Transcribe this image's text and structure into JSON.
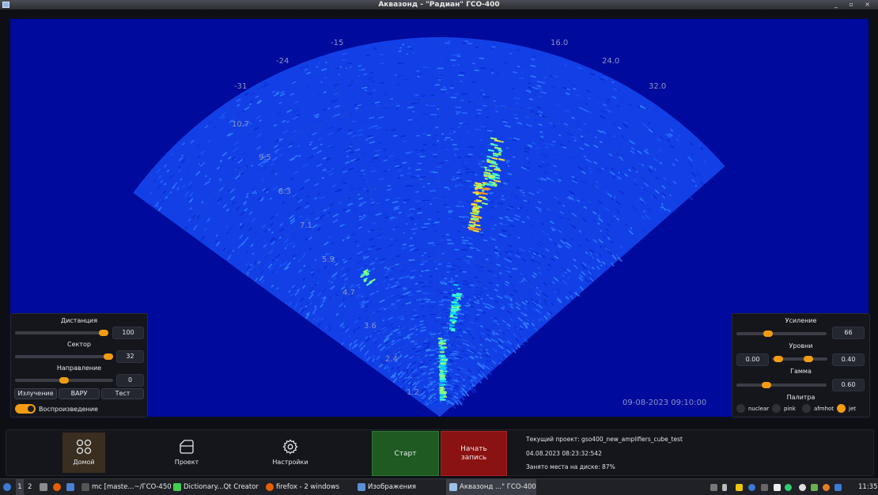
{
  "window": {
    "title": "Аквазонд  - \"Радиан\" ГСО-400",
    "controls": "_ ▫ ×"
  },
  "sonar": {
    "angle_labels": [
      "-31",
      "-24",
      "-15",
      "16.0",
      "24.0",
      "32.0"
    ],
    "range_labels": [
      "10.7",
      "9.5",
      "8.3",
      "7.1",
      "5.9",
      "4.7",
      "3.6",
      "2.4",
      "1.2"
    ],
    "timestamp": "09-08-2023 09:10:00",
    "colors": {
      "background": "#000a9c",
      "labels": "#8a93c8"
    }
  },
  "left_panel": {
    "distance": {
      "label": "Дистанция",
      "value": "100",
      "level": 0.95
    },
    "sector": {
      "label": "Сектор",
      "value": "32",
      "level": 0.97
    },
    "direction": {
      "label": "Направление",
      "value": "0",
      "level": 0.5
    },
    "buttons": [
      "Излучение",
      "ВАРУ",
      "Тест"
    ],
    "playback": {
      "label": "Воспроизведение",
      "on": true
    }
  },
  "right_panel": {
    "gain": {
      "label": "Усиление",
      "value": "66",
      "level": 0.32
    },
    "levels": {
      "label": "Уровни",
      "low": "0.00",
      "high": "0.40",
      "low_level": 0.1,
      "high_level": 0.4
    },
    "gamma": {
      "label": "Гамма",
      "value": "0.60",
      "level": 0.3
    },
    "palette": {
      "label": "Палитра",
      "options": [
        "nuclear",
        "pink",
        "afmhot",
        "jet"
      ],
      "selected": "jet"
    }
  },
  "nav": {
    "home": "Домой",
    "project": "Проект",
    "settings": "Настройки"
  },
  "actions": {
    "start": "Старт",
    "record": "Начать\nзапись"
  },
  "info": {
    "project": "Текущий проект: gso400_new_amplifiers_cube_test",
    "datetime": "04.08.2023  08:23:32:542",
    "disk": "Занято места на диске: 87%"
  },
  "taskbar": {
    "workspaces": [
      "1",
      "2"
    ],
    "tasks": [
      "mc [maste...~/ГСО-450",
      "Dictionary...Qt Creator",
      "firefox - 2 windows",
      "Изображения",
      "Аквазонд ...\" ГСО-400"
    ],
    "clock": "11:35"
  },
  "accent": "#f39c12"
}
